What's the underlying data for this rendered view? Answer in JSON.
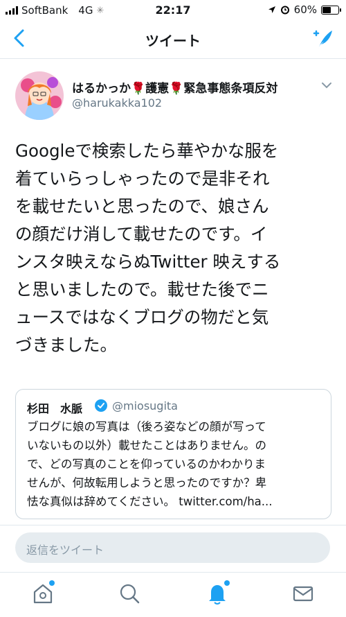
{
  "status_bar": {
    "carrier": "SoftBank",
    "network": "4G",
    "time": "22:17",
    "battery": "60%",
    "battery_level": 0.6
  },
  "nav": {
    "title": "ツイート",
    "back_icon": "back-chevron-icon",
    "compose_icon": "compose-feather-icon"
  },
  "tweet": {
    "author": {
      "name_part1": "はるかっか",
      "name_part2": "護憲",
      "name_part3": "緊急事態条項反対",
      "rose_emoji": "🌹",
      "handle": "@harukakka102"
    },
    "text": "Googleで検索したら華やかな服を\n着ていらっしゃったので是非それ\nを載せたいと思ったので、娘さん\nの顔だけ消して載せたのです。イ\nンスタ映えならぬTwitter 映えする\nと思いましたので。載せた後でニ\nュースではなくブログの物だと気\nづきました。"
  },
  "quoted_tweet": {
    "name": "杉田　水脈",
    "handle": "@miosugita",
    "text": "ブログに娘の写真は（後ろ姿などの顔が写って\nいないもの以外）載せたことはありません。の\nで、どの写真のことを仰っているのかわかりま\nせんが、何故転用しようと思ったのですか？卑\n怯な真似は辞めてください。 twitter.com/ha..."
  },
  "reply": {
    "placeholder": "返信をツイート"
  },
  "tabbar": {
    "items": [
      "home-icon",
      "search-icon",
      "notifications-icon",
      "messages-icon"
    ],
    "accent": "#1da1f2"
  }
}
